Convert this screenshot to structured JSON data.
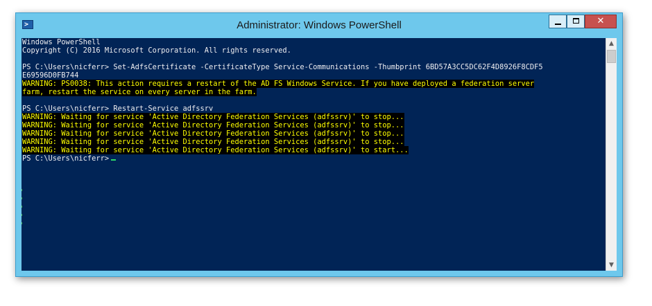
{
  "window": {
    "title": "Administrator: Windows PowerShell",
    "icon": "powershell-icon",
    "controls": {
      "minimize_icon": "minimize-icon",
      "maximize_icon": "maximize-icon",
      "close_icon": "close-icon",
      "close_glyph": "✕"
    }
  },
  "console": {
    "colors": {
      "background": "#012456",
      "text": "#eeedf0",
      "warning_text": "#ffff00",
      "warning_background": "#000000",
      "cursor": "#2bd96a"
    },
    "lines": [
      {
        "text": "Windows PowerShell",
        "kind": "normal"
      },
      {
        "text": "Copyright (C) 2016 Microsoft Corporation. All rights reserved.",
        "kind": "normal"
      },
      {
        "text": "",
        "kind": "normal"
      },
      {
        "text": "PS C:\\Users\\nicferr> Set-AdfsCertificate -CertificateType Service-Communications -Thumbprint 6BD57A3CC5DC62F4D8926F8CDF5",
        "kind": "normal"
      },
      {
        "text": "E69596D0FB744",
        "kind": "normal"
      },
      {
        "text": "WARNING: PS0038: This action requires a restart of the AD FS Windows Service. If you have deployed a federation server",
        "kind": "warning"
      },
      {
        "text": "farm, restart the service on every server in the farm.",
        "kind": "warning"
      },
      {
        "text": "",
        "kind": "normal"
      },
      {
        "text": "PS C:\\Users\\nicferr> Restart-Service adfssrv",
        "kind": "normal"
      },
      {
        "text": "WARNING: Waiting for service 'Active Directory Federation Services (adfssrv)' to stop...",
        "kind": "warning"
      },
      {
        "text": "WARNING: Waiting for service 'Active Directory Federation Services (adfssrv)' to stop...",
        "kind": "warning"
      },
      {
        "text": "WARNING: Waiting for service 'Active Directory Federation Services (adfssrv)' to stop...",
        "kind": "warning"
      },
      {
        "text": "WARNING: Waiting for service 'Active Directory Federation Services (adfssrv)' to stop...",
        "kind": "warning"
      },
      {
        "text": "WARNING: Waiting for service 'Active Directory Federation Services (adfssrv)' to start...",
        "kind": "warning"
      },
      {
        "text": "PS C:\\Users\\nicferr>",
        "kind": "prompt"
      }
    ]
  },
  "scrollbar": {
    "up_icon": "scroll-up-arrow-icon",
    "down_icon": "scroll-down-arrow-icon",
    "up_glyph": "▲",
    "down_glyph": "▼"
  }
}
